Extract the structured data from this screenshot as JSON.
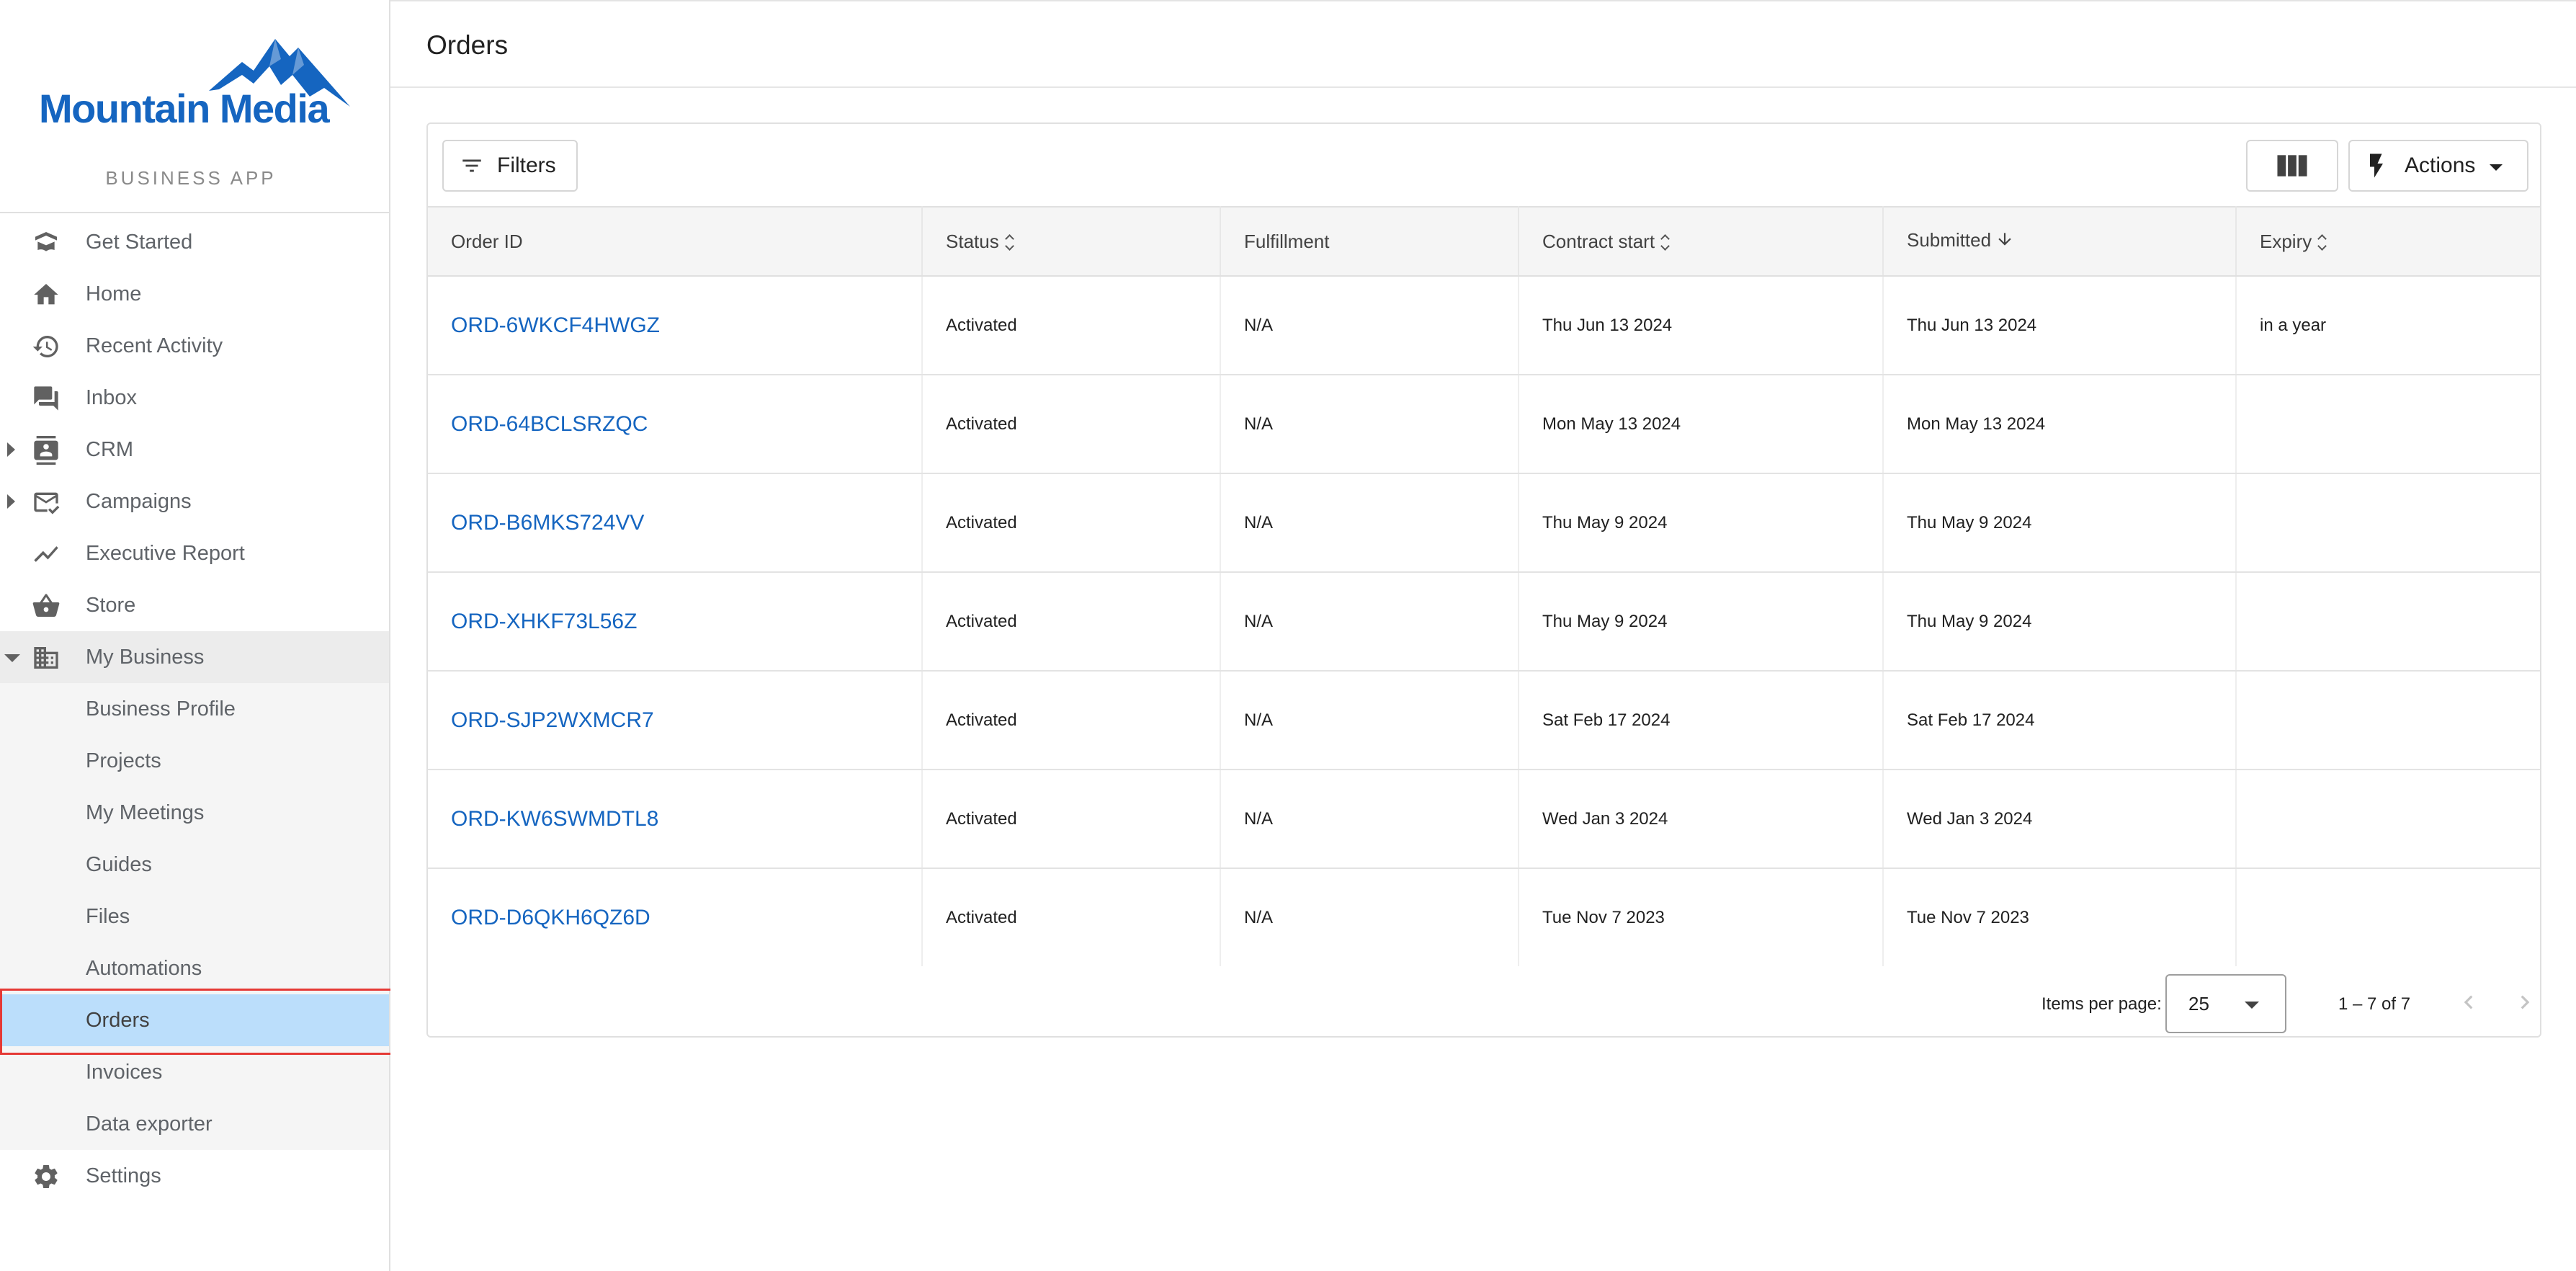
{
  "brand": {
    "name": "Mountain Media",
    "subtitle": "BUSINESS APP",
    "color": "#1565c0"
  },
  "sidebar": {
    "items": [
      {
        "label": "Get Started",
        "icon": "book-open-icon"
      },
      {
        "label": "Home",
        "icon": "home-icon"
      },
      {
        "label": "Recent Activity",
        "icon": "history-icon"
      },
      {
        "label": "Inbox",
        "icon": "chat-icon"
      },
      {
        "label": "CRM",
        "icon": "contacts-icon",
        "expandable": true
      },
      {
        "label": "Campaigns",
        "icon": "mail-check-icon",
        "expandable": true
      },
      {
        "label": "Executive Report",
        "icon": "trending-icon"
      },
      {
        "label": "Store",
        "icon": "basket-icon"
      },
      {
        "label": "My Business",
        "icon": "building-icon",
        "expanded": true
      }
    ],
    "my_business_children": [
      {
        "label": "Business Profile"
      },
      {
        "label": "Projects"
      },
      {
        "label": "My Meetings"
      },
      {
        "label": "Guides"
      },
      {
        "label": "Files"
      },
      {
        "label": "Automations"
      },
      {
        "label": "Orders",
        "active": true
      },
      {
        "label": "Invoices"
      },
      {
        "label": "Data exporter"
      }
    ],
    "settings": {
      "label": "Settings",
      "icon": "gear-icon"
    }
  },
  "page": {
    "title": "Orders"
  },
  "toolbar": {
    "filters_label": "Filters",
    "actions_label": "Actions"
  },
  "table": {
    "columns": {
      "order_id": "Order ID",
      "status": "Status",
      "fulfillment": "Fulfillment",
      "contract_start": "Contract start",
      "submitted": "Submitted",
      "expiry": "Expiry"
    },
    "rows": [
      {
        "order_id": "ORD-6WKCF4HWGZ",
        "status": "Activated",
        "fulfillment": "N/A",
        "contract_start": "Thu Jun 13 2024",
        "submitted": "Thu Jun 13 2024",
        "expiry": "in a year"
      },
      {
        "order_id": "ORD-64BCLSRZQC",
        "status": "Activated",
        "fulfillment": "N/A",
        "contract_start": "Mon May 13 2024",
        "submitted": "Mon May 13 2024",
        "expiry": ""
      },
      {
        "order_id": "ORD-B6MKS724VV",
        "status": "Activated",
        "fulfillment": "N/A",
        "contract_start": "Thu May 9 2024",
        "submitted": "Thu May 9 2024",
        "expiry": ""
      },
      {
        "order_id": "ORD-XHKF73L56Z",
        "status": "Activated",
        "fulfillment": "N/A",
        "contract_start": "Thu May 9 2024",
        "submitted": "Thu May 9 2024",
        "expiry": ""
      },
      {
        "order_id": "ORD-SJP2WXMCR7",
        "status": "Activated",
        "fulfillment": "N/A",
        "contract_start": "Sat Feb 17 2024",
        "submitted": "Sat Feb 17 2024",
        "expiry": ""
      },
      {
        "order_id": "ORD-KW6SWMDTL8",
        "status": "Activated",
        "fulfillment": "N/A",
        "contract_start": "Wed Jan 3 2024",
        "submitted": "Wed Jan 3 2024",
        "expiry": ""
      },
      {
        "order_id": "ORD-D6QKH6QZ6D",
        "status": "Activated",
        "fulfillment": "N/A",
        "contract_start": "Tue Nov 7 2023",
        "submitted": "Tue Nov 7 2023",
        "expiry": ""
      }
    ]
  },
  "paginator": {
    "items_per_page_label": "Items per page:",
    "items_per_page": "25",
    "range": "1 – 7 of 7"
  },
  "colors": {
    "link": "#1565c0",
    "active_nav_bg": "#bbdefb",
    "highlight_outline": "#e53935"
  }
}
